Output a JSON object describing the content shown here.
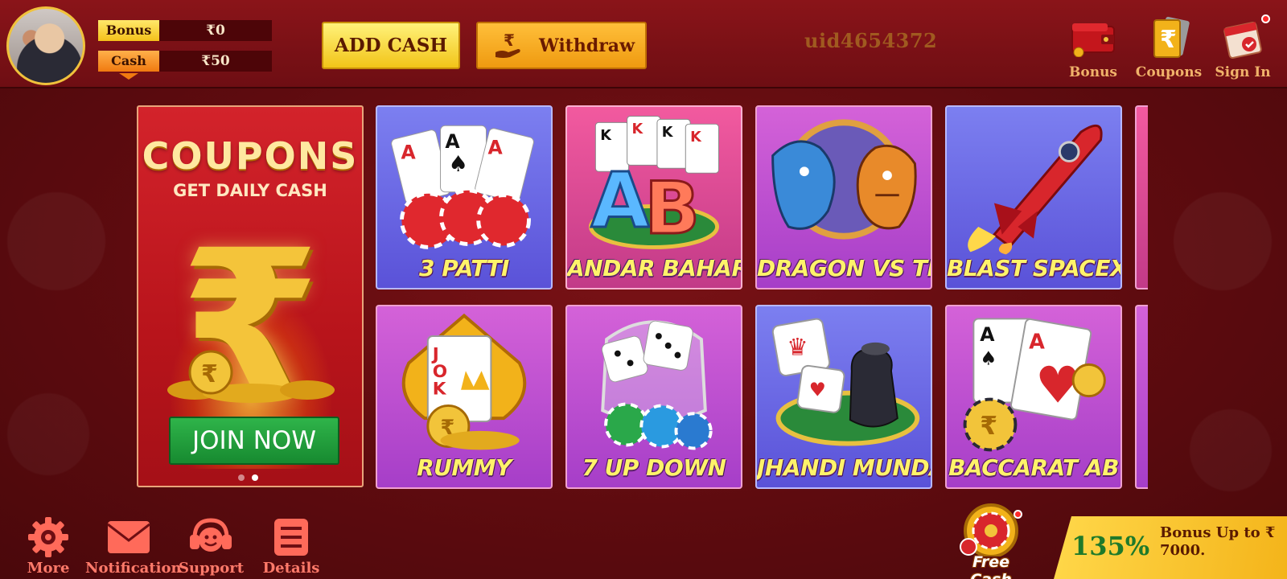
{
  "header": {
    "bonus_label": "Bonus",
    "bonus_value": "₹0",
    "cash_label": "Cash",
    "cash_value": "₹50",
    "add_cash_label": "ADD CASH",
    "withdraw_label": "Withdraw",
    "uid": "uid4654372",
    "icons": [
      {
        "label": "Bonus",
        "icon": "wallet-icon"
      },
      {
        "label": "Coupons",
        "icon": "coupons-icon"
      },
      {
        "label": "Sign In",
        "icon": "calendar-icon"
      }
    ]
  },
  "promo": {
    "title": "COUPONS",
    "subtitle": "GET DAILY CASH",
    "symbol": "₹",
    "button_label": "JOIN NOW",
    "slides": 2,
    "active_slide": 2
  },
  "games": [
    {
      "name": "3 PATTI",
      "icon": "cards-chips-icon",
      "theme": "blue"
    },
    {
      "name": "ANDAR BAHAR",
      "icon": "ab-cards-icon",
      "theme": "pink"
    },
    {
      "name": "DRAGON VS TIGER",
      "icon": "dragon-tiger-icon",
      "theme": "purple"
    },
    {
      "name": "BLAST SPACEX",
      "icon": "rocket-icon",
      "theme": "blue"
    },
    {
      "name": "RUMMY",
      "icon": "joker-card-icon",
      "theme": "purple"
    },
    {
      "name": "7 UP DOWN",
      "icon": "dice-icon",
      "theme": "purple"
    },
    {
      "name": "JHANDI MUNDA",
      "icon": "jhandi-dice-icon",
      "theme": "blue"
    },
    {
      "name": "BACCARAT AB",
      "icon": "baccarat-cards-icon",
      "theme": "purple"
    }
  ],
  "footer": {
    "items": [
      {
        "label": "More",
        "icon": "gear-icon"
      },
      {
        "label": "Notification",
        "icon": "mail-icon"
      },
      {
        "label": "Support",
        "icon": "headset-icon"
      },
      {
        "label": "Details",
        "icon": "details-icon"
      }
    ],
    "free_cash_label": "Free Cash",
    "bonus_percent": "135%",
    "bonus_text": "Bonus Up to ₹ 7000."
  },
  "colors": {
    "background": "#6e0e13",
    "accent_yellow": "#f2c418",
    "accent_orange": "#ef9a10",
    "join_green": "#2fb44a",
    "game_label": "#fff36a"
  }
}
